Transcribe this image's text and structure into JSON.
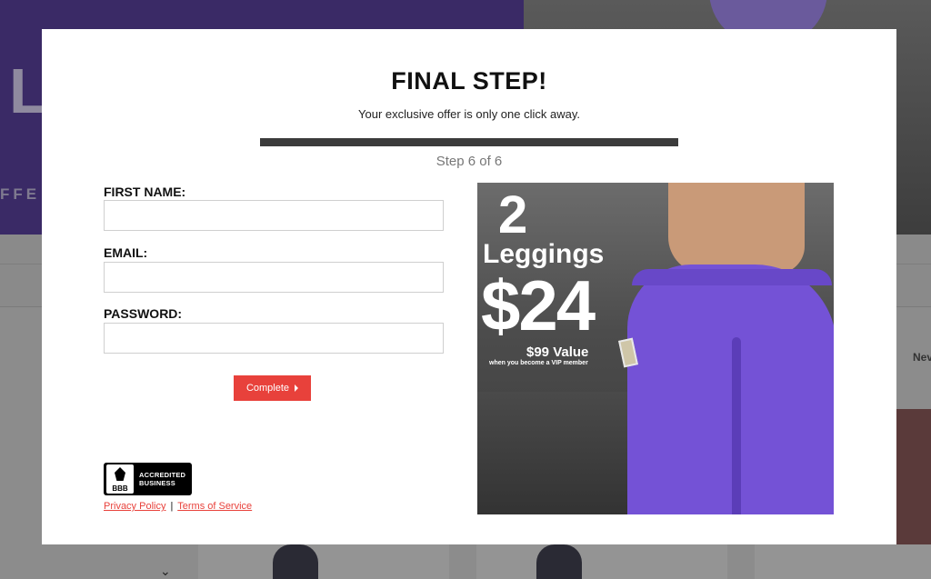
{
  "background": {
    "hero_word": "L",
    "hero_sub": "FFE",
    "nav_item": "Nev",
    "chevron": "⌄"
  },
  "modal": {
    "title": "FINAL STEP!",
    "subtitle": "Your exclusive offer is only one click away.",
    "progress": 1.0,
    "step_text": "Step 6 of 6",
    "fields": {
      "first_name": {
        "label": "FIRST NAME:",
        "value": ""
      },
      "email": {
        "label": "EMAIL:",
        "value": ""
      },
      "password": {
        "label": "PASSWORD:",
        "value": ""
      }
    },
    "complete_button": "Complete",
    "badge": {
      "logo_text": "BBB",
      "line1": "ACCREDITED",
      "line2": "BUSINESS"
    },
    "links": {
      "privacy": "Privacy Policy",
      "separator": "|",
      "terms": "Terms of Service"
    },
    "promo": {
      "count": "2",
      "product": "Leggings",
      "price": "$24",
      "value": "$99 Value",
      "note": "when you become a VIP member"
    }
  },
  "colors": {
    "accent": "#e8413b",
    "progress": "#3b3b3b",
    "legging_purple": "#7452d6"
  }
}
